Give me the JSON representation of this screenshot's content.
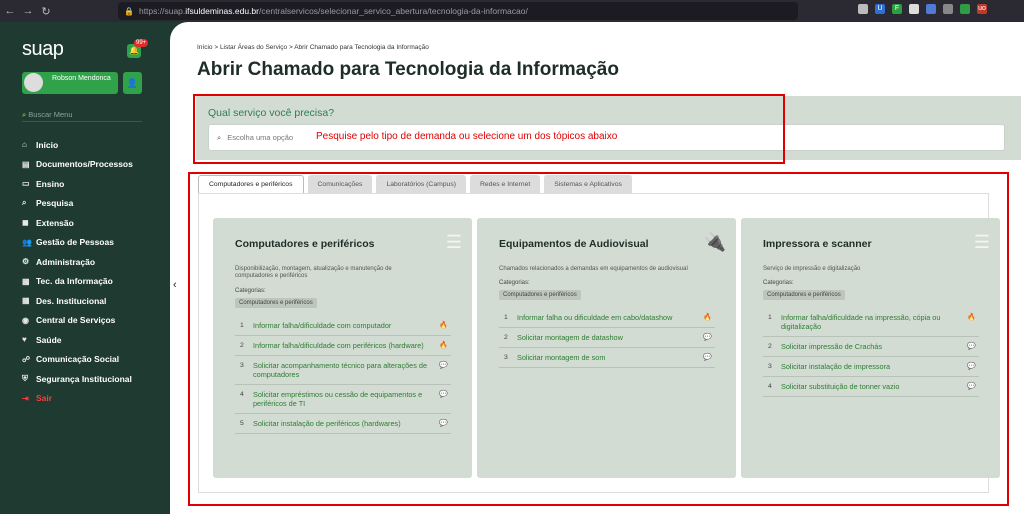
{
  "browser": {
    "url_prefix": "https://suap.",
    "url_host": "ifsuldeminas.edu.br",
    "url_path": "/centralservicos/selecionar_servico_abertura/tecnologia-da-informacao/",
    "extensions": [
      {
        "label": "",
        "color": "#bbbbbb"
      },
      {
        "label": "U",
        "color": "#2f6fd1"
      },
      {
        "label": "F",
        "color": "#2e9e44"
      },
      {
        "label": "",
        "color": "#dddddd"
      },
      {
        "label": "",
        "color": "#4f7ad6"
      },
      {
        "label": "",
        "color": "#888888"
      },
      {
        "label": "",
        "color": "#2e9e44"
      },
      {
        "label": "uo",
        "color": "#c0392b"
      }
    ]
  },
  "sidebar": {
    "logo": "suap",
    "notification_count": "99+",
    "user_name": "Robson Mendonca",
    "search_placeholder": "Buscar Menu",
    "items": [
      {
        "label": "Início",
        "icon": "⌂"
      },
      {
        "label": "Documentos/Processos",
        "icon": "▤"
      },
      {
        "label": "Ensino",
        "icon": "▭"
      },
      {
        "label": "Pesquisa",
        "icon": "⌕"
      },
      {
        "label": "Extensão",
        "icon": "◼"
      },
      {
        "label": "Gestão de Pessoas",
        "icon": "👥"
      },
      {
        "label": "Administração",
        "icon": "⚙"
      },
      {
        "label": "Tec. da Informação",
        "icon": "▦"
      },
      {
        "label": "Des. Institucional",
        "icon": "▦"
      },
      {
        "label": "Central de Serviços",
        "icon": "◉"
      },
      {
        "label": "Saúde",
        "icon": "♥"
      },
      {
        "label": "Comunicação Social",
        "icon": "☍"
      },
      {
        "label": "Segurança Institucional",
        "icon": "⛨"
      },
      {
        "label": "Sair",
        "icon": "⇥",
        "danger": true
      }
    ]
  },
  "breadcrumb": "Início  >  Listar Áreas do Serviço  >  Abrir Chamado para Tecnologia da Informação",
  "page_title": "Abrir Chamado para Tecnologia da Informação",
  "search": {
    "question": "Qual serviço você precisa?",
    "placeholder": "Escolha uma opção",
    "annotation": "Pesquise pelo tipo de demanda ou selecione um dos tópicos abaixo"
  },
  "tabs": [
    {
      "label": "Computadores e periféricos",
      "active": true
    },
    {
      "label": "Comunicações"
    },
    {
      "label": "Laboratórios (Campus)"
    },
    {
      "label": "Redes e Internet"
    },
    {
      "label": "Sistemas e Aplicativos"
    }
  ],
  "cards": [
    {
      "title": "Computadores e periféricos",
      "icon": "list-icon",
      "description": "Disponibilização, montagem, atualização e manutenção de computadores e periféricos",
      "categories_label": "Categorias:",
      "category": "Computadores e periféricos",
      "services": [
        {
          "num": "1",
          "label": "Informar falha/dificuldade com computador",
          "icon": "fire-icon"
        },
        {
          "num": "2",
          "label": "Informar falha/dificuldade com periféricos (hardware)",
          "icon": "fire-icon"
        },
        {
          "num": "3",
          "label": "Solicitar acompanhamento técnico para alterações de computadores",
          "icon": "comment-icon"
        },
        {
          "num": "4",
          "label": "Solicitar empréstimos ou cessão de equipamentos e periféricos de TI",
          "icon": "comment-icon"
        },
        {
          "num": "5",
          "label": "Solicitar instalação de periféricos (hardwares)",
          "icon": "comment-icon"
        }
      ]
    },
    {
      "title": "Equipamentos de Audiovisual",
      "icon": "plug-icon",
      "description": "Chamados relacionados a demandas em equipamentos de audiovisual",
      "categories_label": "Categorias:",
      "category": "Computadores e periféricos",
      "services": [
        {
          "num": "1",
          "label": "Informar falha ou dificuldade em cabo/datashow",
          "icon": "fire-icon"
        },
        {
          "num": "2",
          "label": "Solicitar montagem de datashow",
          "icon": "comment-icon"
        },
        {
          "num": "3",
          "label": "Solicitar montagem de som",
          "icon": "comment-icon"
        }
      ]
    },
    {
      "title": "Impressora e scanner",
      "icon": "list-icon",
      "description": "Serviço de impressão e digitalização",
      "categories_label": "Categorias:",
      "category": "Computadores e periféricos",
      "services": [
        {
          "num": "1",
          "label": "Informar falha/dificuldade na impressão, cópia ou digitalização",
          "icon": "fire-icon"
        },
        {
          "num": "2",
          "label": "Solicitar impressão de Crachás",
          "icon": "comment-icon"
        },
        {
          "num": "3",
          "label": "Solicitar instalação de impressora",
          "icon": "comment-icon"
        },
        {
          "num": "4",
          "label": "Solicitar substituição de tonner vazio",
          "icon": "comment-icon"
        }
      ]
    }
  ]
}
